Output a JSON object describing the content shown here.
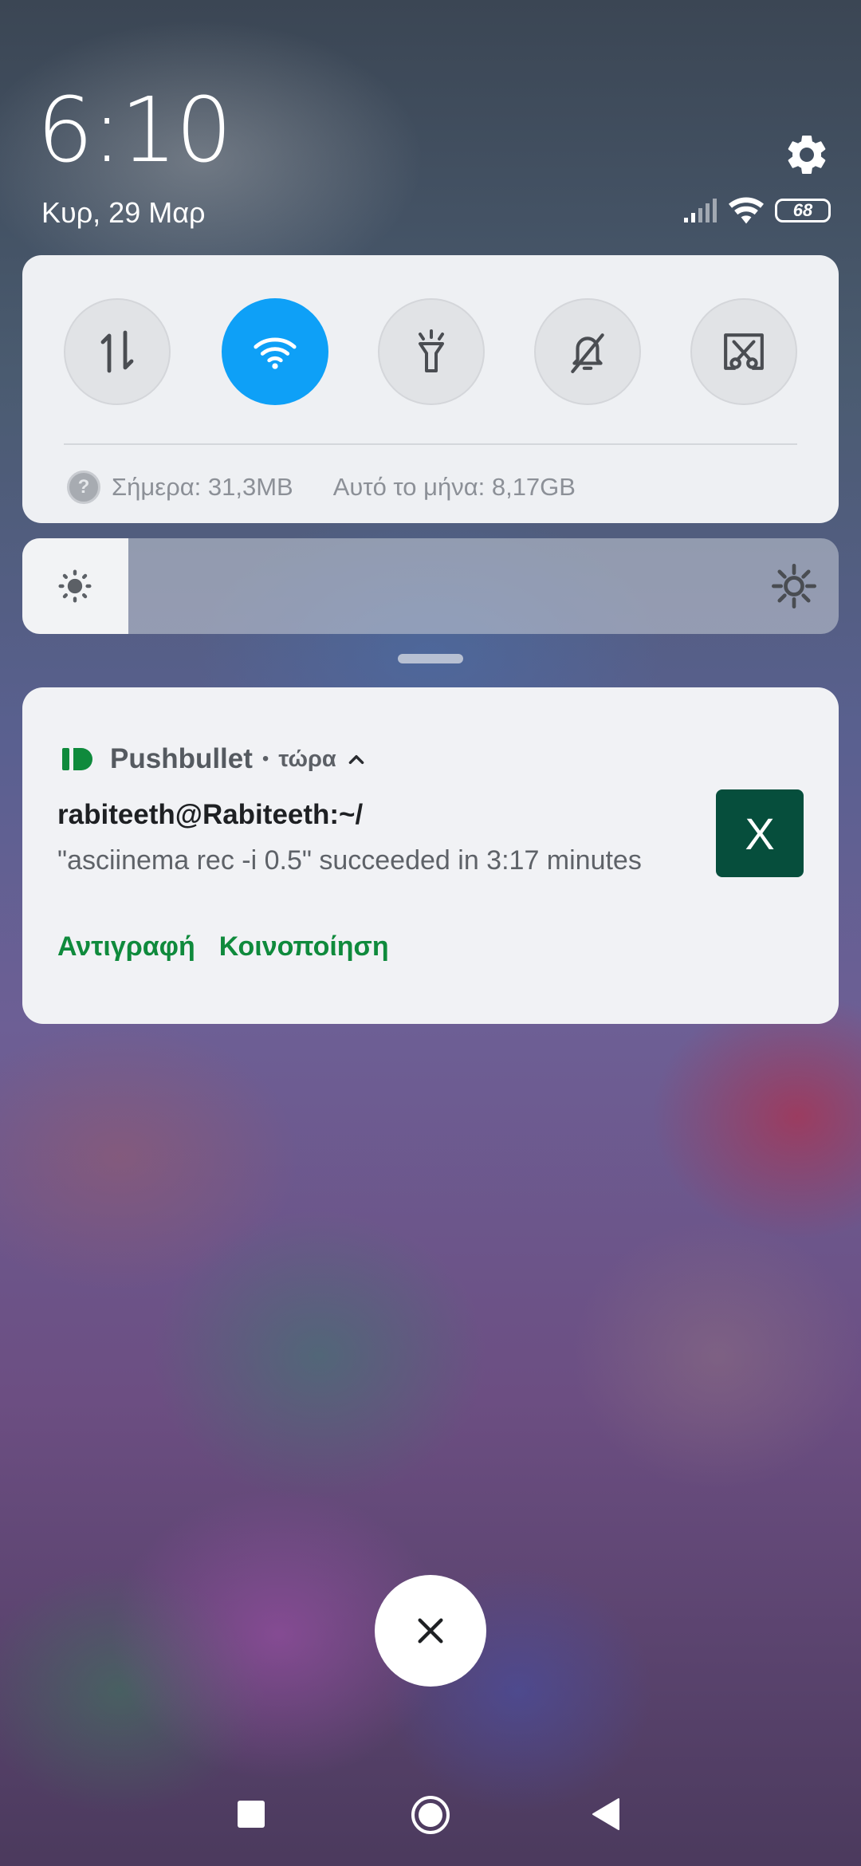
{
  "header": {
    "time": "6:10",
    "date": "Κυρ, 29 Μαρ",
    "battery_level": "68",
    "icons": [
      "settings-icon",
      "signal-icon",
      "wifi-icon",
      "battery-icon"
    ]
  },
  "quick_settings": {
    "tiles": [
      {
        "name": "mobile-data",
        "icon": "data-transfer-icon",
        "active": false
      },
      {
        "name": "wifi",
        "icon": "wifi-icon",
        "active": true
      },
      {
        "name": "flashlight",
        "icon": "flashlight-icon",
        "active": false
      },
      {
        "name": "silent",
        "icon": "bell-off-icon",
        "active": false
      },
      {
        "name": "screenshot",
        "icon": "screenshot-icon",
        "active": false
      }
    ],
    "data_usage": {
      "today": "Σήμερα: 31,3MB",
      "month": "Αυτό το μήνα: 8,17GB"
    },
    "accent_color": "#0ea0f7"
  },
  "brightness": {
    "level_fraction": 0.13
  },
  "notification": {
    "app_name": "Pushbullet",
    "time": "τώρα",
    "title": "rabiteeth@Rabiteeth:~/",
    "text": "\"asciinema rec -i 0.5\" succeeded in 3:17 minutes",
    "thumbnail_letter": "X",
    "actions": [
      "Αντιγραφή",
      "Κοινοποίηση"
    ],
    "brand_color": "#0f8a3c"
  }
}
